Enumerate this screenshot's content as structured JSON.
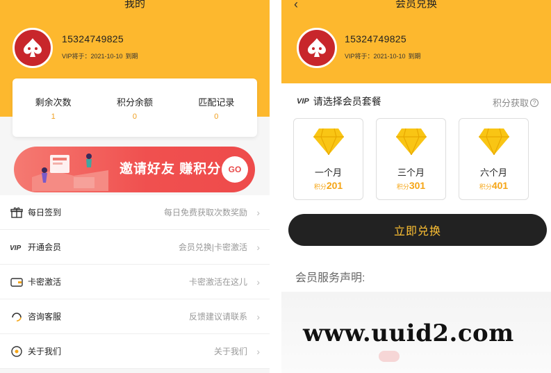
{
  "left": {
    "nav_title": "我的",
    "user": {
      "phone": "15324749825",
      "vip_prefix": "VIP将于：2021-10-10",
      "vip_suffix": "到期"
    },
    "stats": [
      {
        "label": "剩余次数",
        "value": "1"
      },
      {
        "label": "积分余额",
        "value": "0"
      },
      {
        "label": "匹配记录",
        "value": "0"
      }
    ],
    "banner": {
      "text": "邀请好友 赚积分",
      "go": "GO"
    },
    "menu": [
      {
        "icon": "gift-icon",
        "label": "每日签到",
        "hint": "每日免费获取次数奖励"
      },
      {
        "icon": "vip-icon",
        "label": "开通会员",
        "hint": "会员兑换|卡密激活"
      },
      {
        "icon": "card-icon",
        "label": "卡密激活",
        "hint": "卡密激活在这儿"
      },
      {
        "icon": "headset-icon",
        "label": "咨询客服",
        "hint": "反馈建议请联系"
      },
      {
        "icon": "info-icon",
        "label": "关于我们",
        "hint": "关于我们"
      }
    ],
    "chevron": "›"
  },
  "right": {
    "nav_title": "会员兑换",
    "back_icon": "‹",
    "user": {
      "phone": "15324749825",
      "vip_prefix": "VIP将于：2021-10-10",
      "vip_suffix": "到期"
    },
    "section_vip_mark": "VIP",
    "section_title": "请选择会员套餐",
    "earn_link": "积分获取",
    "earn_icon": "?",
    "plans": [
      {
        "name": "一个月",
        "unit": "积分",
        "price": "201"
      },
      {
        "name": "三个月",
        "unit": "积分",
        "price": "301"
      },
      {
        "name": "六个月",
        "unit": "积分",
        "price": "401"
      }
    ],
    "redeem_button": "立即兑换",
    "declaration": "会员服务声明:"
  },
  "watermark": "www.uuid2.com",
  "colors": {
    "brand_yellow": "#fdb82e",
    "accent_orange": "#f5a516",
    "banner_red": "#f0504f",
    "button_dark": "#222222",
    "avatar_red": "#c8262b"
  }
}
